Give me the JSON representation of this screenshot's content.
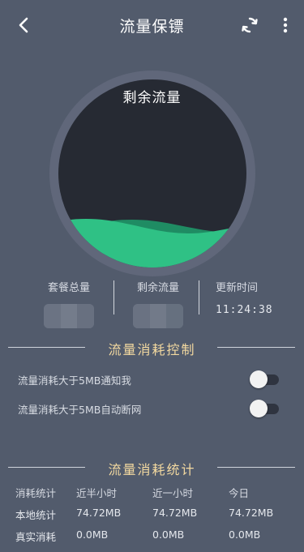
{
  "appbar": {
    "title": "流量保镖",
    "back_icon": "chevron-left-icon",
    "refresh_icon": "refresh-icon",
    "more_icon": "more-vertical-icon"
  },
  "gauge": {
    "label": "剩余流量",
    "value": "",
    "fill_fraction": 0.22,
    "colors": {
      "ring": "#60677a",
      "disc": "#262a33",
      "wave_front": "#2fc185",
      "wave_back": "#1f8c63"
    }
  },
  "stats": {
    "package_total": {
      "label": "套餐总量",
      "value": ""
    },
    "remaining": {
      "label": "剩余流量",
      "value": ""
    },
    "updated": {
      "label": "更新时间",
      "value": "11:24:38"
    }
  },
  "control": {
    "title": "流量消耗控制",
    "items": [
      {
        "label": "流量消耗大于5MB通知我",
        "on": false
      },
      {
        "label": "流量消耗大于5MB自动断网",
        "on": false
      }
    ]
  },
  "statistics": {
    "title": "流量消耗统计",
    "headers": [
      "消耗统计",
      "近半小时",
      "近一小时",
      "今日"
    ],
    "rows": [
      [
        "本地统计",
        "74.72MB",
        "74.72MB",
        "74.72MB"
      ],
      [
        "真实消耗",
        "0.0MB",
        "0.0MB",
        "0.0MB"
      ]
    ]
  },
  "colors": {
    "background": "#525b6c",
    "accent_gold": "#f3d9a0",
    "accent_green": "#2fc185"
  }
}
